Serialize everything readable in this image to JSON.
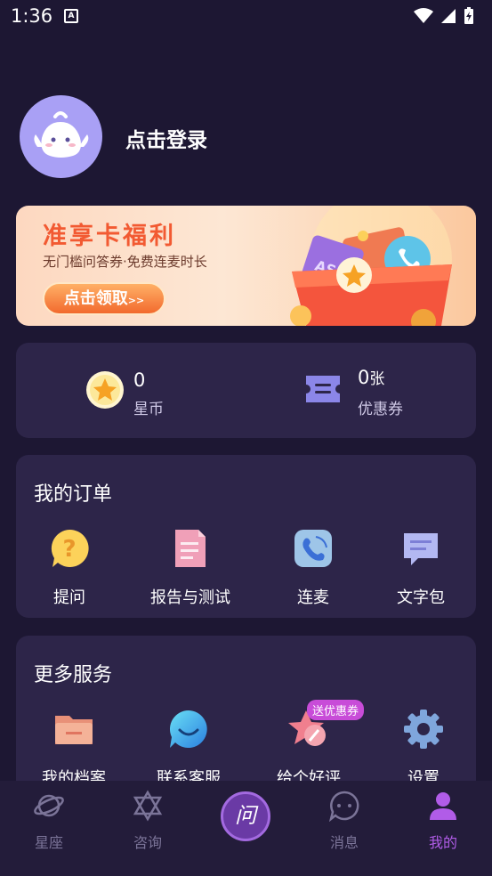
{
  "status_bar": {
    "time": "1:36",
    "notif_glyph": "A"
  },
  "profile": {
    "login_text": "点击登录"
  },
  "banner": {
    "title": "准享卡福利",
    "subtitle": "无门槛问答券·免费连麦时长",
    "button_label": "点击领取",
    "button_arrow": ">>",
    "coupon_text": "AS"
  },
  "wallet": {
    "coins": {
      "value": "0",
      "label": "星币"
    },
    "coupons": {
      "value": "0",
      "unit": "张",
      "label": "优惠券"
    }
  },
  "orders": {
    "title": "我的订单",
    "items": [
      {
        "label": "提问",
        "icon": "question-icon"
      },
      {
        "label": "报告与测试",
        "icon": "document-icon"
      },
      {
        "label": "连麦",
        "icon": "phone-icon"
      },
      {
        "label": "文字包",
        "icon": "chat-icon"
      }
    ]
  },
  "services": {
    "title": "更多服务",
    "badge": "送优惠券",
    "items": [
      {
        "label": "我的档案",
        "icon": "folder-icon"
      },
      {
        "label": "联系客服",
        "icon": "smile-bubble-icon"
      },
      {
        "label": "给个好评",
        "icon": "star-pencil-icon"
      },
      {
        "label": "设置",
        "icon": "gear-icon"
      }
    ]
  },
  "tabbar": {
    "center_glyph": "问",
    "tabs": [
      {
        "label": "星座",
        "icon": "planet-icon",
        "active": false
      },
      {
        "label": "咨询",
        "icon": "hexagram-icon",
        "active": false
      },
      {
        "label": "消息",
        "icon": "message-icon",
        "active": false
      },
      {
        "label": "我的",
        "icon": "user-icon",
        "active": true
      }
    ]
  },
  "colors": {
    "background": "#1d1733",
    "card": "#2d2549",
    "accent": "#b15ce8",
    "banner_title": "#f25a32"
  }
}
